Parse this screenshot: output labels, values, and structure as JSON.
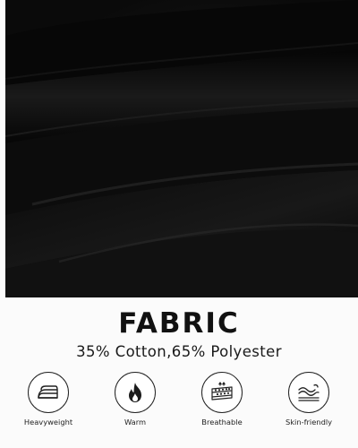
{
  "heading": {
    "title": "FABRIC",
    "subtitle": "35% Cotton,65% Polyester"
  },
  "features": [
    {
      "label": "Heavyweight",
      "icon": "folded-fabric-icon"
    },
    {
      "label": "Warm",
      "icon": "flame-icon"
    },
    {
      "label": "Breathable",
      "icon": "breathable-layers-icon"
    },
    {
      "label": "Skin-friendly",
      "icon": "skin-wave-icon"
    }
  ],
  "colors": {
    "fabric": "#0a0a0a",
    "background": "#fbfbfb",
    "text": "#111111"
  }
}
